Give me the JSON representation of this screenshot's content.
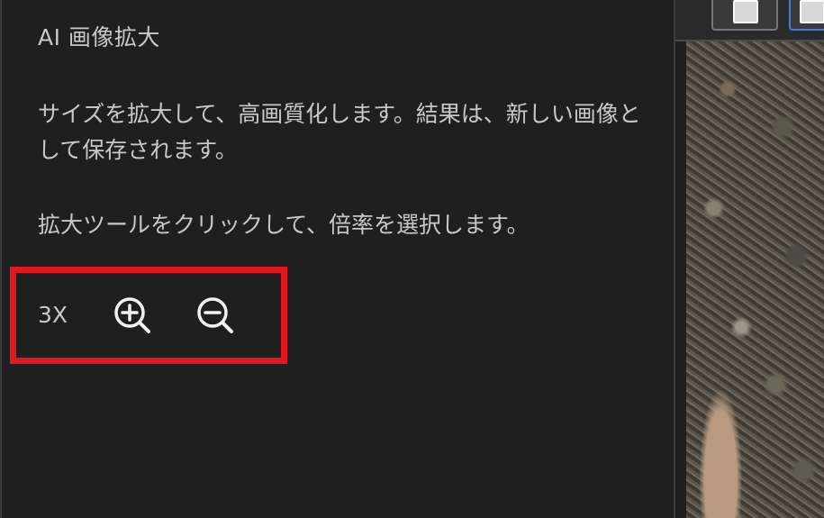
{
  "panel": {
    "title": "AI 画像拡大",
    "description": "サイズを拡大して、高画質化します。結果は、新しい画像として保存されます。",
    "instruction": "拡大ツールをクリックして、倍率を選択します。"
  },
  "zoom": {
    "level": "3X",
    "zoom_in_icon": "zoom-in-icon",
    "zoom_out_icon": "zoom-out-icon",
    "highlight_color": "#e3161f"
  },
  "colors": {
    "panel_bg": "#1f1f1f",
    "text": "#c8c8c8"
  }
}
